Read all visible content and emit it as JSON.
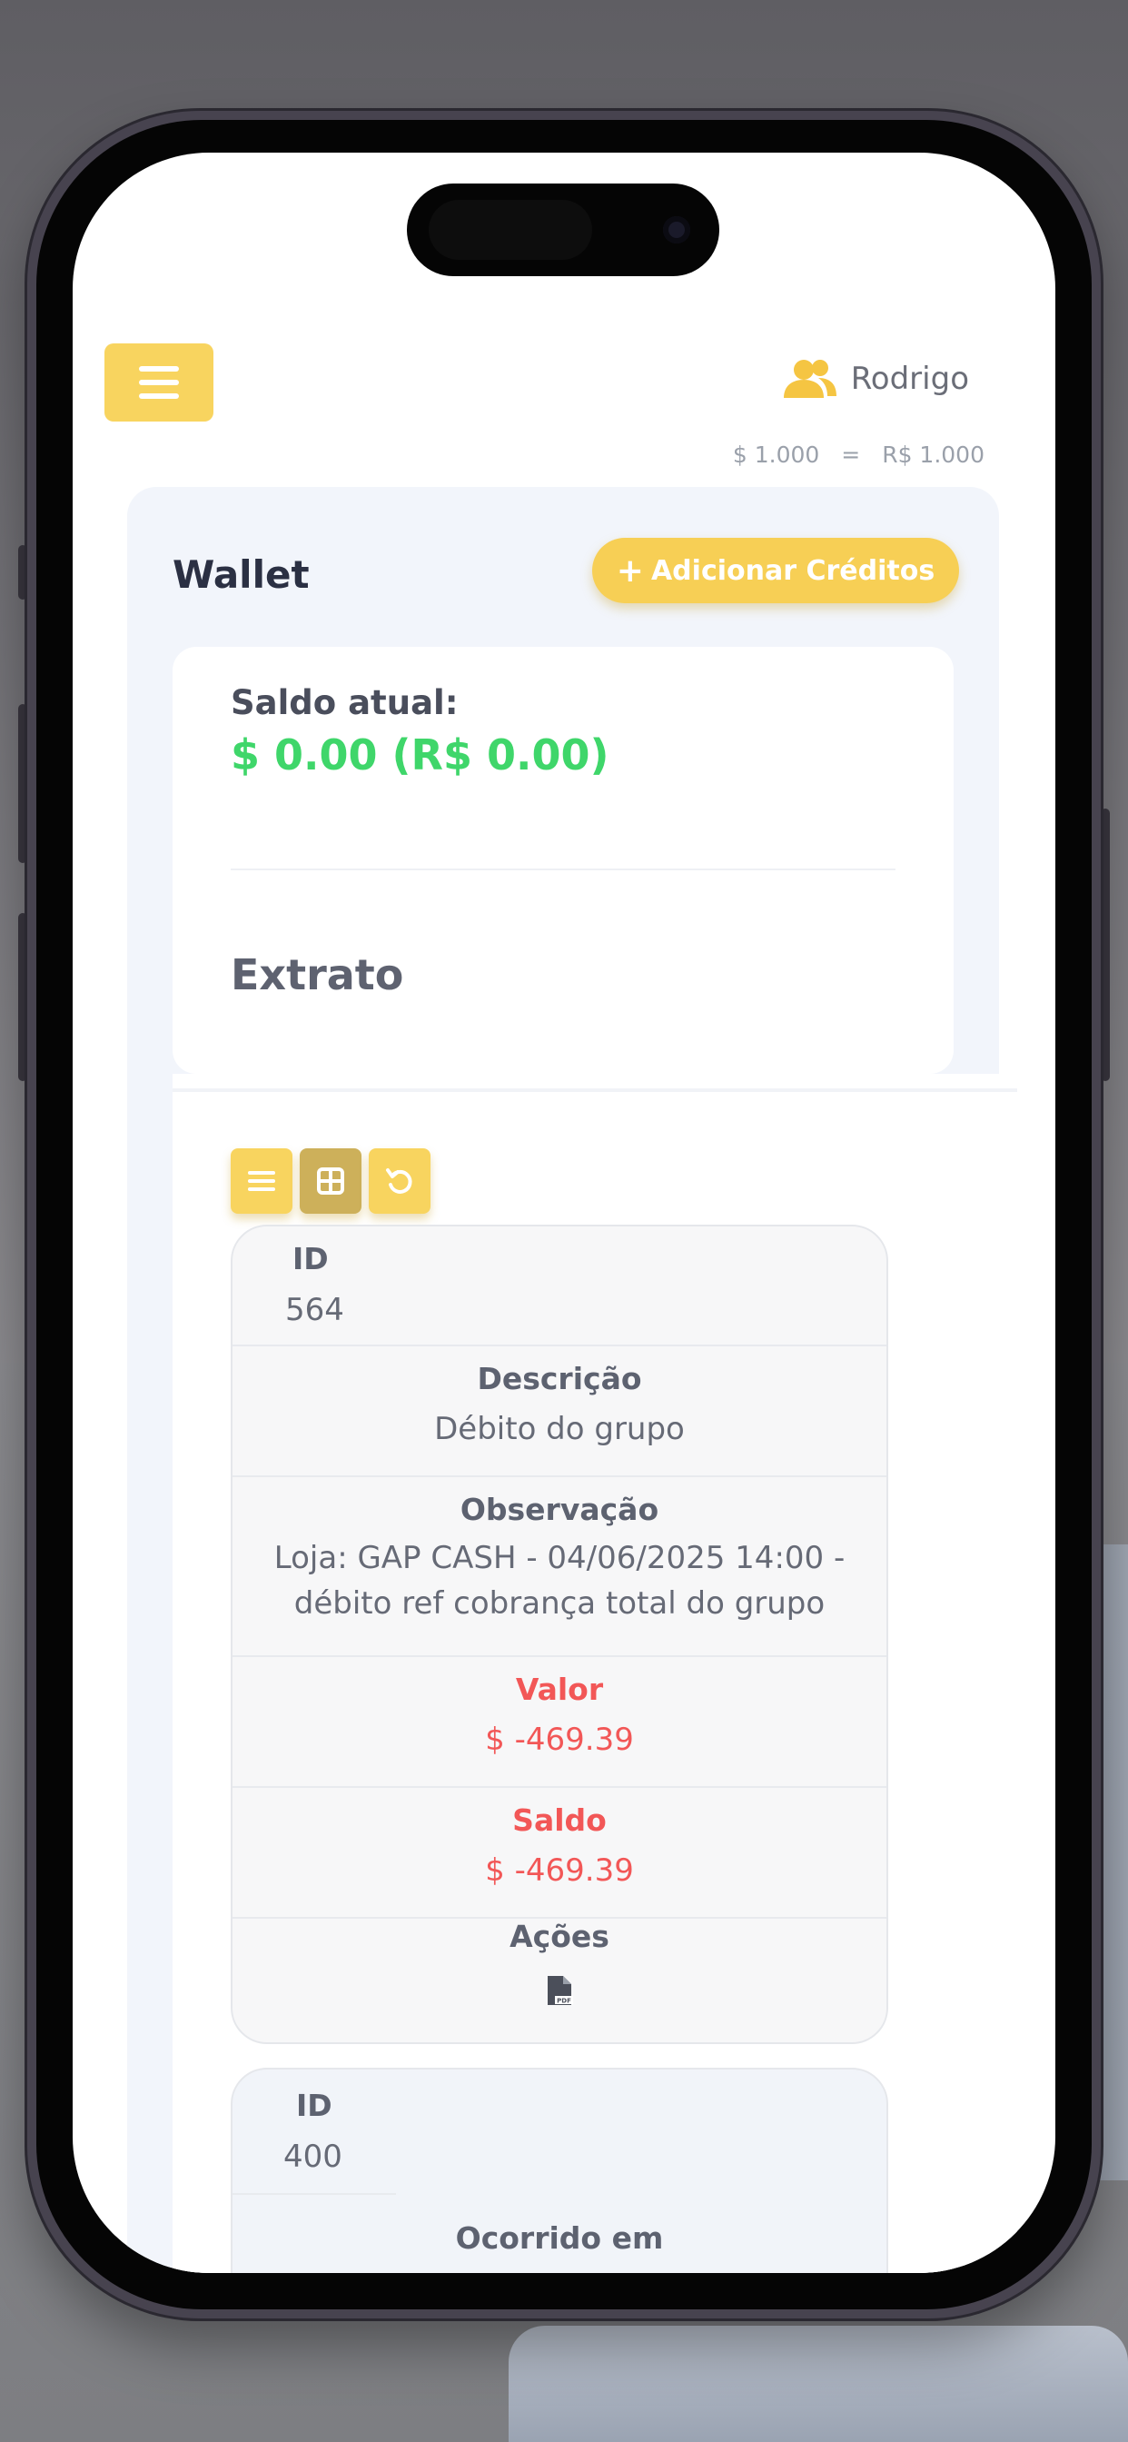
{
  "header": {
    "user_name": "Rodrigo",
    "rate_usd": "$ 1.000",
    "rate_eq": "=",
    "rate_brl": "R$ 1.000"
  },
  "wallet": {
    "title": "Wallet",
    "add_credits_label": "Adicionar Créditos",
    "balance_label": "Saldo atual:",
    "balance_value": "$ 0.00 (R$ 0.00)"
  },
  "statement": {
    "title": "Extrato",
    "view_buttons": [
      "list-icon",
      "grid-icon",
      "refresh-icon"
    ],
    "records": [
      {
        "id_label": "ID",
        "id": "564",
        "description_label": "Descrição",
        "description": "Débito do grupo",
        "note_label": "Observação",
        "note_line1": "Loja: GAP CASH - 04/06/2025 14:00 -",
        "note_line2": "débito ref cobrança total do grupo",
        "value_label": "Valor",
        "value": "$ -469.39",
        "balance_label": "Saldo",
        "balance": "$ -469.39",
        "actions_label": "Ações",
        "action_icon": "pdf-icon"
      },
      {
        "id_label": "ID",
        "id": "400",
        "occurred_label": "Ocorrido em"
      }
    ]
  },
  "colors": {
    "accent": "#f8d45f",
    "positive": "#3fd66a",
    "negative": "#f25757"
  }
}
